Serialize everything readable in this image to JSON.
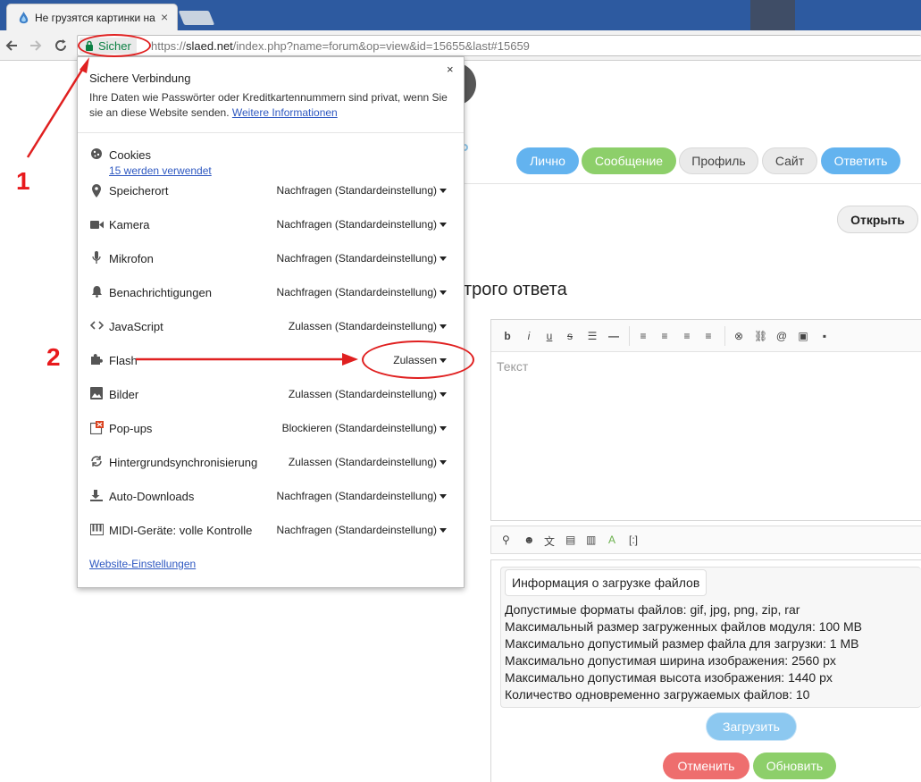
{
  "browser": {
    "tab": {
      "title": "Не грузятся картинки на",
      "close": "×"
    },
    "url": {
      "protocol": "https://",
      "host": "slaed.net",
      "path": "/index.php?name=forum&op=view&id=15655&last#15659"
    },
    "secure_label": "Sicher"
  },
  "annotations": {
    "step1": "1",
    "step2": "2"
  },
  "popup": {
    "title": "Sichere Verbindung",
    "close": "×",
    "description": "Ihre Daten wie Passwörter oder Kreditkartennummern sind privat, wenn Sie sie an diese Website senden.",
    "more_info": "Weitere Informationen",
    "cookies": {
      "label": "Cookies",
      "link": "15 werden verwendet"
    },
    "permissions": [
      {
        "label": "Speicherort",
        "value": "Nachfragen (Standardeinstellung)",
        "icon": "location-icon"
      },
      {
        "label": "Kamera",
        "value": "Nachfragen (Standardeinstellung)",
        "icon": "camera-icon"
      },
      {
        "label": "Mikrofon",
        "value": "Nachfragen (Standardeinstellung)",
        "icon": "microphone-icon"
      },
      {
        "label": "Benachrichtigungen",
        "value": "Nachfragen (Standardeinstellung)",
        "icon": "bell-icon"
      },
      {
        "label": "JavaScript",
        "value": "Zulassen (Standardeinstellung)",
        "icon": "code-icon"
      },
      {
        "label": "Flash",
        "value": "Zulassen",
        "icon": "puzzle-icon"
      },
      {
        "label": "Bilder",
        "value": "Zulassen (Standardeinstellung)",
        "icon": "image-icon"
      },
      {
        "label": "Pop-ups",
        "value": "Blockieren (Standardeinstellung)",
        "icon": "popup-icon"
      },
      {
        "label": "Hintergrundsynchronisierung",
        "value": "Zulassen (Standardeinstellung)",
        "icon": "sync-icon"
      },
      {
        "label": "Auto-Downloads",
        "value": "Nachfragen (Standardeinstellung)",
        "icon": "download-icon"
      },
      {
        "label": "MIDI-Geräte: volle Kontrolle",
        "value": "Nachfragen (Standardeinstellung)",
        "icon": "piano-icon"
      }
    ],
    "site_settings": "Website-Einstellungen"
  },
  "page": {
    "post_buttons": [
      "Лично",
      "Сообщение",
      "Профиль",
      "Сайт",
      "Ответить"
    ],
    "open_button": "Открыть",
    "fast_reply_title": "трого ответа",
    "editor": {
      "placeholder": "Текст"
    },
    "upload": {
      "title": "Информация о загрузке файлов",
      "lines": [
        "Допустимые форматы файлов: gif, jpg, png, zip, rar",
        "Максимальный размер загруженных файлов модуля: 100 MB",
        "Максимально допустимый размер файла для загрузки: 1 MB",
        "Максимально допустимая ширина изображения: 2560 px",
        "Максимально допустимая высота изображения: 1440 px",
        "Количество одновременно загружаемых файлов: 10"
      ],
      "upload_button": "Загрузить"
    },
    "cancel_button": "Отменить",
    "update_button": "Обновить"
  },
  "colors": {
    "accent_blue": "#63b3ef",
    "accent_green": "#8dcf6a",
    "cancel_red": "#ee6e6e",
    "annotation_red": "#e8191c",
    "secure_green": "#0b8043"
  }
}
